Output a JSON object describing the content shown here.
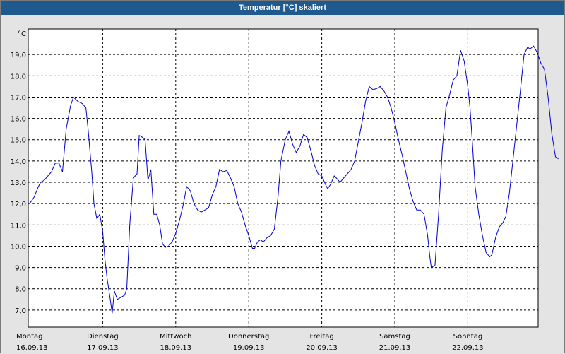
{
  "window": {
    "title": "Temperatur [°C] skaliert"
  },
  "chart_data": {
    "type": "line",
    "title": "Temperatur [°C] skaliert",
    "ylabel": "°C",
    "xlabel": "",
    "ylim": [
      6.2,
      20.2
    ],
    "xlim": [
      0,
      7
    ],
    "grid": true,
    "line_color": "#0000cc",
    "yticks": [
      7.0,
      8.0,
      9.0,
      10.0,
      11.0,
      12.0,
      13.0,
      14.0,
      15.0,
      16.0,
      17.0,
      18.0,
      19.0
    ],
    "ytick_labels": [
      "7,0",
      "8,0",
      "9,0",
      "10,0",
      "11,0",
      "12,0",
      "13,0",
      "14,0",
      "15,0",
      "16,0",
      "17,0",
      "18,0",
      "19,0"
    ],
    "xticks": [
      {
        "day": "Montag",
        "date": "16.09.13",
        "x": 0
      },
      {
        "day": "Dienstag",
        "date": "17.09.13",
        "x": 1
      },
      {
        "day": "Mittwoch",
        "date": "18.09.13",
        "x": 2
      },
      {
        "day": "Donnerstag",
        "date": "19.09.13",
        "x": 3
      },
      {
        "day": "Freitag",
        "date": "20.09.13",
        "x": 4
      },
      {
        "day": "Samstag",
        "date": "21.09.13",
        "x": 5
      },
      {
        "day": "Sonntag",
        "date": "22.09.13",
        "x": 6
      }
    ],
    "series": [
      {
        "x_unit": "days since Montag 16.09.13 00:00",
        "points": [
          [
            0.0,
            12.0
          ],
          [
            0.06,
            12.3
          ],
          [
            0.12,
            12.8
          ],
          [
            0.15,
            13.0
          ],
          [
            0.2,
            13.1
          ],
          [
            0.25,
            13.3
          ],
          [
            0.3,
            13.5
          ],
          [
            0.35,
            13.9
          ],
          [
            0.4,
            13.9
          ],
          [
            0.45,
            13.5
          ],
          [
            0.5,
            15.5
          ],
          [
            0.56,
            16.6
          ],
          [
            0.6,
            17.0
          ],
          [
            0.66,
            16.8
          ],
          [
            0.72,
            16.7
          ],
          [
            0.77,
            16.5
          ],
          [
            0.8,
            15.5
          ],
          [
            0.85,
            13.5
          ],
          [
            0.88,
            12.0
          ],
          [
            0.92,
            11.3
          ],
          [
            0.96,
            11.5
          ],
          [
            1.0,
            10.7
          ],
          [
            1.03,
            9.4
          ],
          [
            1.06,
            8.5
          ],
          [
            1.1,
            7.6
          ],
          [
            1.13,
            6.85
          ],
          [
            1.16,
            7.9
          ],
          [
            1.2,
            7.5
          ],
          [
            1.25,
            7.6
          ],
          [
            1.3,
            7.7
          ],
          [
            1.33,
            8.0
          ],
          [
            1.37,
            11.0
          ],
          [
            1.42,
            13.2
          ],
          [
            1.47,
            13.4
          ],
          [
            1.5,
            15.2
          ],
          [
            1.55,
            15.1
          ],
          [
            1.58,
            15.0
          ],
          [
            1.62,
            13.1
          ],
          [
            1.66,
            13.6
          ],
          [
            1.7,
            11.5
          ],
          [
            1.74,
            11.5
          ],
          [
            1.78,
            11.0
          ],
          [
            1.82,
            10.1
          ],
          [
            1.86,
            9.95
          ],
          [
            1.9,
            10.0
          ],
          [
            1.95,
            10.2
          ],
          [
            2.0,
            10.6
          ],
          [
            2.05,
            11.2
          ],
          [
            2.1,
            11.9
          ],
          [
            2.15,
            12.8
          ],
          [
            2.2,
            12.6
          ],
          [
            2.25,
            12.0
          ],
          [
            2.3,
            11.7
          ],
          [
            2.35,
            11.6
          ],
          [
            2.4,
            11.7
          ],
          [
            2.45,
            11.8
          ],
          [
            2.5,
            12.4
          ],
          [
            2.55,
            12.8
          ],
          [
            2.6,
            13.6
          ],
          [
            2.65,
            13.5
          ],
          [
            2.7,
            13.55
          ],
          [
            2.75,
            13.2
          ],
          [
            2.8,
            12.8
          ],
          [
            2.85,
            12.0
          ],
          [
            2.9,
            11.6
          ],
          [
            2.95,
            11.0
          ],
          [
            3.0,
            10.5
          ],
          [
            3.05,
            9.9
          ],
          [
            3.08,
            9.9
          ],
          [
            3.12,
            10.2
          ],
          [
            3.16,
            10.3
          ],
          [
            3.2,
            10.2
          ],
          [
            3.25,
            10.4
          ],
          [
            3.3,
            10.5
          ],
          [
            3.35,
            10.8
          ],
          [
            3.4,
            12.3
          ],
          [
            3.44,
            14.0
          ],
          [
            3.5,
            15.0
          ],
          [
            3.55,
            15.4
          ],
          [
            3.6,
            14.8
          ],
          [
            3.65,
            14.4
          ],
          [
            3.7,
            14.7
          ],
          [
            3.75,
            15.25
          ],
          [
            3.8,
            15.1
          ],
          [
            3.85,
            14.5
          ],
          [
            3.9,
            13.8
          ],
          [
            3.95,
            13.4
          ],
          [
            4.0,
            13.3
          ],
          [
            4.05,
            12.9
          ],
          [
            4.08,
            12.7
          ],
          [
            4.12,
            12.9
          ],
          [
            4.17,
            13.3
          ],
          [
            4.2,
            13.2
          ],
          [
            4.25,
            13.0
          ],
          [
            4.3,
            13.2
          ],
          [
            4.35,
            13.4
          ],
          [
            4.4,
            13.6
          ],
          [
            4.45,
            14.0
          ],
          [
            4.5,
            14.9
          ],
          [
            4.55,
            15.8
          ],
          [
            4.6,
            16.8
          ],
          [
            4.65,
            17.5
          ],
          [
            4.7,
            17.35
          ],
          [
            4.75,
            17.4
          ],
          [
            4.8,
            17.5
          ],
          [
            4.85,
            17.3
          ],
          [
            4.9,
            17.0
          ],
          [
            4.95,
            16.5
          ],
          [
            5.0,
            15.8
          ],
          [
            5.05,
            15.0
          ],
          [
            5.1,
            14.3
          ],
          [
            5.15,
            13.5
          ],
          [
            5.2,
            12.7
          ],
          [
            5.25,
            12.1
          ],
          [
            5.3,
            11.7
          ],
          [
            5.35,
            11.7
          ],
          [
            5.4,
            11.5
          ],
          [
            5.45,
            10.5
          ],
          [
            5.48,
            9.5
          ],
          [
            5.5,
            9.0
          ],
          [
            5.55,
            9.1
          ],
          [
            5.6,
            11.5
          ],
          [
            5.65,
            14.5
          ],
          [
            5.7,
            16.5
          ],
          [
            5.75,
            17.1
          ],
          [
            5.8,
            17.8
          ],
          [
            5.85,
            18.0
          ],
          [
            5.9,
            19.2
          ],
          [
            5.95,
            18.7
          ],
          [
            6.0,
            17.5
          ],
          [
            6.03,
            16.5
          ],
          [
            6.06,
            15.0
          ],
          [
            6.1,
            12.8
          ],
          [
            6.15,
            11.5
          ],
          [
            6.2,
            10.5
          ],
          [
            6.25,
            9.7
          ],
          [
            6.3,
            9.5
          ],
          [
            6.33,
            9.6
          ],
          [
            6.38,
            10.4
          ],
          [
            6.43,
            10.9
          ],
          [
            6.48,
            11.1
          ],
          [
            6.52,
            11.4
          ],
          [
            6.57,
            12.5
          ],
          [
            6.62,
            14.1
          ],
          [
            6.67,
            15.7
          ],
          [
            6.72,
            17.3
          ],
          [
            6.77,
            19.0
          ],
          [
            6.82,
            19.35
          ],
          [
            6.85,
            19.25
          ],
          [
            6.9,
            19.4
          ],
          [
            6.95,
            19.1
          ],
          [
            7.0,
            18.6
          ],
          [
            7.05,
            18.3
          ],
          [
            7.1,
            17.0
          ],
          [
            7.15,
            15.3
          ],
          [
            7.2,
            14.2
          ],
          [
            7.24,
            14.1
          ]
        ]
      }
    ]
  }
}
